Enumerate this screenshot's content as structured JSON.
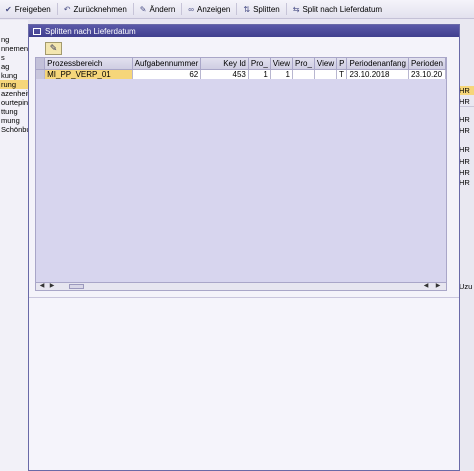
{
  "toolbar": {
    "items": [
      {
        "label": "Freigeben",
        "icon": "release-icon",
        "glyph": "✔"
      },
      {
        "label": "Zurücknehmen",
        "icon": "undo-icon",
        "glyph": "↶"
      },
      {
        "label": "Ändern",
        "icon": "pencil-icon",
        "glyph": "✎"
      },
      {
        "label": "Anzeigen",
        "icon": "glasses-icon",
        "glyph": "∞"
      },
      {
        "label": "Splitten",
        "icon": "split-icon",
        "glyph": "⇅"
      },
      {
        "label": "Split nach Lieferdatum",
        "icon": "split-date-icon",
        "glyph": "⇆"
      }
    ]
  },
  "left_nav": {
    "items": [
      "ng",
      "nnement",
      "s",
      "ag",
      "kung",
      "rung",
      "azenheit",
      "ourtepin",
      "ttung",
      "mung",
      "Schönbu"
    ],
    "selected_index": 5
  },
  "right_bg": {
    "cells": [
      "HR",
      "HR",
      "HR",
      "HR",
      "HR",
      "HR",
      "HR",
      "HR",
      "Uzu"
    ]
  },
  "dialog": {
    "title": "Splitten nach Lieferdatum",
    "toolbar_icon": "edit-icon",
    "grid": {
      "columns": [
        "Prozessbereich",
        "Aufgabennummer",
        "Key Id",
        "Pro_",
        "View",
        "Pro_",
        "View",
        "P",
        "Periodenanfang",
        "Perioden"
      ],
      "rows": [
        [
          "MI_PP_VERP_01",
          "62",
          "453",
          "1",
          "1",
          "",
          "",
          "T",
          "23.10.2018",
          "23.10.20"
        ]
      ]
    }
  }
}
